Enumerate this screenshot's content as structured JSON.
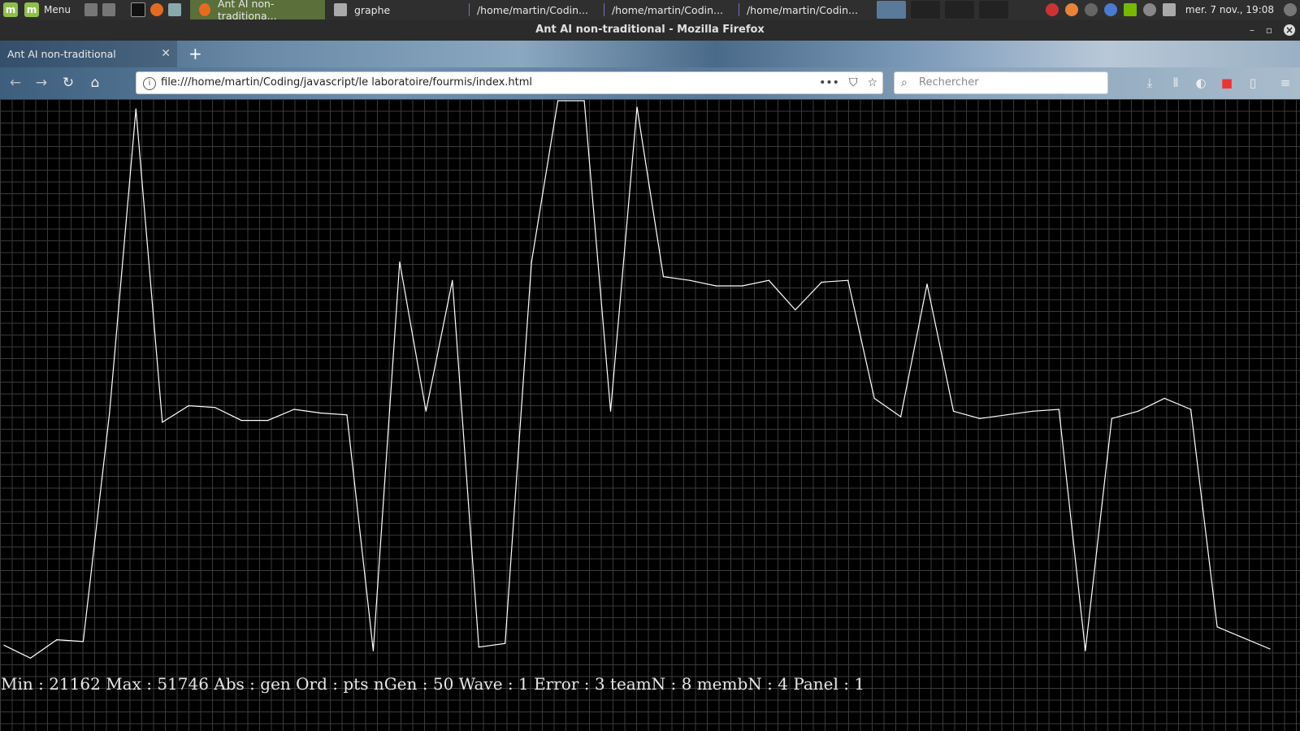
{
  "taskbar": {
    "menu_label": "Menu",
    "windows": [
      {
        "label": "Ant AI non-traditiona...",
        "active": true
      },
      {
        "label": "graphe",
        "active": false
      },
      {
        "label": "/home/martin/Codin...",
        "active": false
      },
      {
        "label": "/home/martin/Codin...",
        "active": false
      },
      {
        "label": "/home/martin/Codin...",
        "active": false
      }
    ],
    "clock": "mer. 7 nov., 19:08"
  },
  "window": {
    "title": "Ant AI non-traditional - Mozilla Firefox"
  },
  "browser": {
    "tab_title": "Ant AI non-traditional",
    "url": "file:///home/martin/Coding/javascript/le laboratoire/fourmis/index.html",
    "search_placeholder": "Rechercher"
  },
  "colors": {
    "page_bg": "#000000",
    "grid": "#3a3a3a",
    "line": "#ffffff",
    "active_window": "#5a6f3a"
  },
  "chart_data": {
    "type": "line",
    "title": "",
    "xlabel": "",
    "ylabel": "",
    "x": [
      1,
      2,
      3,
      4,
      5,
      6,
      7,
      8,
      9,
      10,
      11,
      12,
      13,
      14,
      15,
      16,
      17,
      18,
      19,
      20,
      21,
      22,
      23,
      24,
      25,
      26,
      27,
      28,
      29,
      30,
      31,
      32,
      33,
      34,
      35,
      36,
      37,
      38,
      39,
      40,
      41,
      42,
      43,
      44,
      45,
      46,
      47,
      48,
      49,
      50
    ],
    "ylim": [
      21162,
      51746
    ],
    "series": [
      {
        "values": [
          22200,
          21500,
          22500,
          22400,
          34800,
          51300,
          34300,
          35200,
          35100,
          34400,
          34400,
          35000,
          34800,
          34700,
          21900,
          43000,
          34900,
          42000,
          22100,
          22300,
          43000,
          51746,
          51746,
          34900,
          51400,
          42200,
          42000,
          41700,
          41700,
          42000,
          40400,
          41900,
          42000,
          35600,
          34600,
          41800,
          34900,
          34500,
          34700,
          34900,
          35000,
          21900,
          34500,
          34900,
          35600,
          35000,
          23200,
          22600,
          22000
        ]
      }
    ]
  },
  "status": {
    "text": "Min : 21162 Max : 51746 Abs : gen Ord : pts nGen : 50 Wave : 1 Error : 3 teamN : 8 membN : 4 Panel : 1"
  }
}
